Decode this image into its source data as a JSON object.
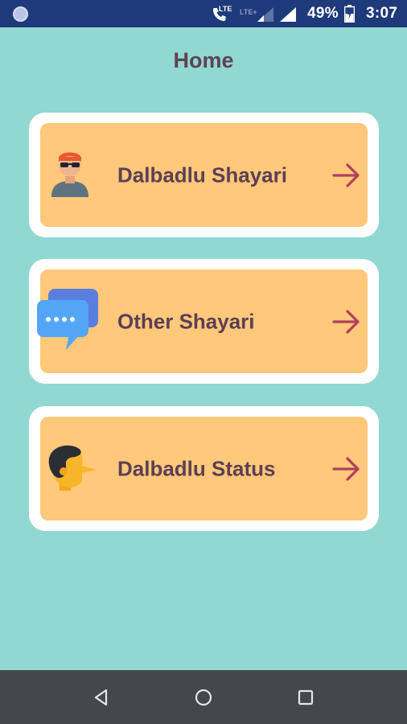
{
  "status_bar": {
    "lte_label": "LTE",
    "lte_plus_label": "LTE+",
    "battery": "49%",
    "time": "3:07"
  },
  "header": {
    "title": "Home"
  },
  "cards": [
    {
      "label": "Dalbadlu Shayari",
      "icon": "person-sunglasses-icon"
    },
    {
      "label": "Other Shayari",
      "icon": "chat-bubbles-icon"
    },
    {
      "label": "Dalbadlu Status",
      "icon": "man-long-nose-icon"
    }
  ],
  "colors": {
    "background": "#92d8d2",
    "card_fill": "#ffc87a",
    "card_border": "#ffffff",
    "text": "#5d3f55",
    "arrow": "#b0405c",
    "status_bar": "#1e3a7a",
    "nav_bar": "#43484c"
  }
}
